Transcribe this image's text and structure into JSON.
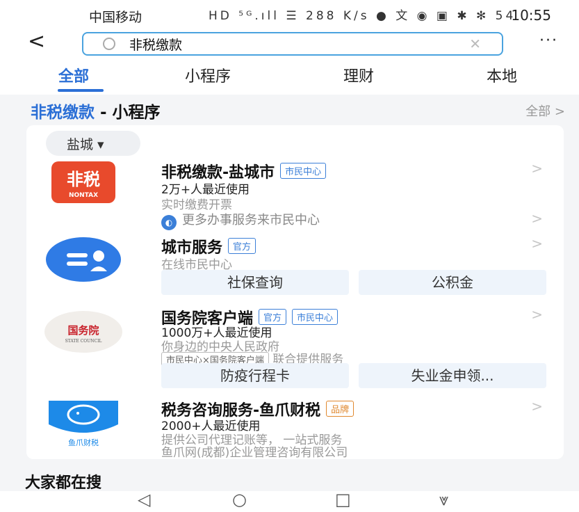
{
  "status_bar": {
    "carrier": "中国移动",
    "icons_text": "HD ⁵ᴳ.ıll ☰ 288 K/s ● 文 ◉ ▣ ✱ ✻ 54",
    "time": "10:55"
  },
  "search": {
    "value": "非税缴款"
  },
  "tabs": [
    {
      "label": "全部"
    },
    {
      "label": "小程序"
    },
    {
      "label": "理财"
    },
    {
      "label": "本地"
    }
  ],
  "section": {
    "title_highlight": "非税缴款",
    "title_rest": " - 小程序",
    "all_link": "全部 >"
  },
  "city_filter": "盐城 ▾",
  "results": [
    {
      "logo_text": "非税",
      "logo_sub": "NONTAX",
      "title": "非税缴款-盐城市",
      "tags": [
        "市民中心"
      ],
      "usage": "2万+人最近使用",
      "desc": "实时缴费开票",
      "extra": "更多办事服务来市民中心"
    },
    {
      "title": "城市服务",
      "tags": [
        "官方"
      ],
      "desc": "在线市民中心",
      "actions": [
        "社保查询",
        "公积金"
      ]
    },
    {
      "logo_text": "国务院",
      "logo_sub": "STATE COUNCIL",
      "title": "国务院客户端",
      "tags": [
        "官方",
        "市民中心"
      ],
      "usage": "1000万+人最近使用",
      "desc": "你身边的中央人民政府",
      "co_badge": "市民中心×国务院客户端",
      "co_text": "联合提供服务",
      "actions": [
        "防疫行程卡",
        "失业金申领..."
      ]
    },
    {
      "logo_text": "鱼爪财税",
      "title": "税务咨询服务-鱼爪财税",
      "tags": [
        "品牌"
      ],
      "usage": "2000+人最近使用",
      "desc": "提供公司代理记账等， 一站式服务",
      "company": "鱼爪网(成都)企业管理咨询有限公司"
    }
  ],
  "trending_title": "大家都在搜",
  "nav": {
    "back": "◁",
    "home": "○",
    "recent": "□",
    "down": "⩔"
  },
  "colors": {
    "accent": "#2b6fd6",
    "brand_orange": "#e0882e"
  }
}
